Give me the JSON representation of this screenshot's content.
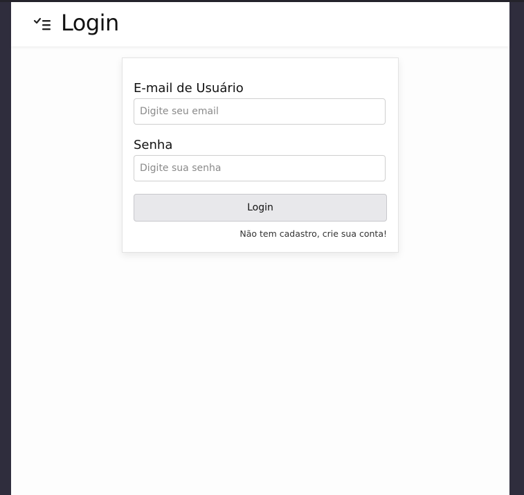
{
  "header": {
    "title": "Login",
    "icon": "checklist-icon"
  },
  "form": {
    "email": {
      "label": "E-mail de Usuário",
      "placeholder": "Digite seu email",
      "value": ""
    },
    "password": {
      "label": "Senha",
      "placeholder": "Digite sua senha",
      "value": ""
    },
    "submit_label": "Login",
    "signup_link": "Não tem cadastro, crie sua conta!"
  },
  "colors": {
    "frame_bg": "#2f2d3d",
    "page_bg": "#fdfdfd",
    "button_bg": "#e8e8eb"
  }
}
